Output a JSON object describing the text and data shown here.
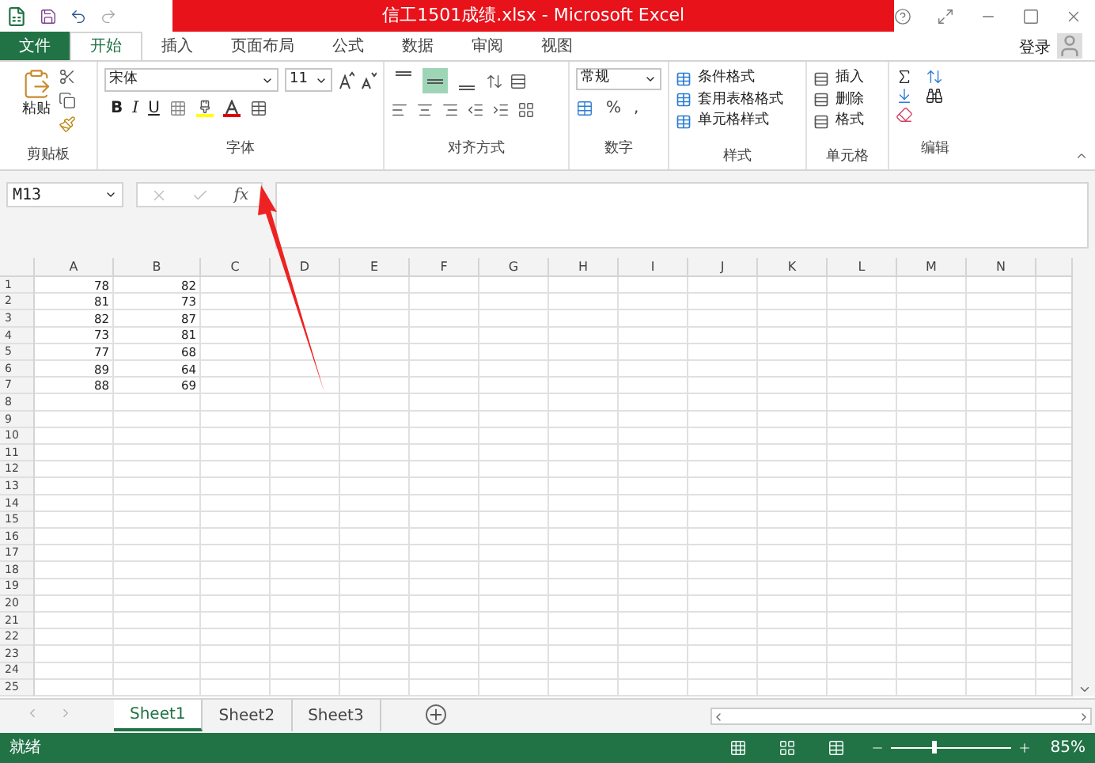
{
  "app": {
    "title": "信工1501成绩.xlsx - Microsoft Excel",
    "account": "登录"
  },
  "tabs": [
    {
      "label": "文件",
      "kind": "file",
      "selected": false
    },
    {
      "label": "开始",
      "kind": "tab",
      "selected": true
    },
    {
      "label": "插入",
      "kind": "tab",
      "selected": false
    },
    {
      "label": "页面布局",
      "kind": "tab",
      "selected": false
    },
    {
      "label": "公式",
      "kind": "tab",
      "selected": false
    },
    {
      "label": "数据",
      "kind": "tab",
      "selected": false
    },
    {
      "label": "审阅",
      "kind": "tab",
      "selected": false
    },
    {
      "label": "视图",
      "kind": "tab",
      "selected": false
    }
  ],
  "ribbon": {
    "clipboard": {
      "paste": "粘贴",
      "label": "剪贴板"
    },
    "font": {
      "name": "宋体",
      "size": "11",
      "bold": "B",
      "italic": "I",
      "underline": "U",
      "label": "字体"
    },
    "alignment": {
      "vertical": [
        {
          "kind": "top",
          "selected": false
        },
        {
          "kind": "middle",
          "selected": true
        },
        {
          "kind": "bottom",
          "selected": false
        }
      ],
      "label": "对齐方式"
    },
    "number": {
      "format": "常规",
      "percent": "%",
      "comma": ",",
      "label": "数字"
    },
    "styles": {
      "items": [
        "条件格式",
        "套用表格格式",
        "单元格样式"
      ],
      "label": "样式"
    },
    "cells": {
      "items": [
        "插入",
        "删除",
        "格式"
      ],
      "label": "单元格"
    },
    "editing": {
      "label": "编辑"
    }
  },
  "formula_bar": {
    "name_box": "M13",
    "function": "fx"
  },
  "sheet": {
    "columns": [
      "A",
      "B",
      "C",
      "D",
      "E",
      "F",
      "G",
      "H",
      "I",
      "J",
      "K",
      "L",
      "M",
      "N"
    ],
    "rows": [
      {
        "number": "1",
        "cells": [
          "78",
          "82"
        ]
      },
      {
        "number": "2",
        "cells": [
          "81",
          "73"
        ]
      },
      {
        "number": "3",
        "cells": [
          "82",
          "87"
        ]
      },
      {
        "number": "4",
        "cells": [
          "73",
          "81"
        ]
      },
      {
        "number": "5",
        "cells": [
          "77",
          "68"
        ]
      },
      {
        "number": "6",
        "cells": [
          "89",
          "64"
        ]
      },
      {
        "number": "7",
        "cells": [
          "88",
          "69"
        ]
      },
      {
        "number": "8",
        "cells": []
      },
      {
        "number": "9",
        "cells": []
      },
      {
        "number": "10",
        "cells": []
      },
      {
        "number": "11",
        "cells": []
      },
      {
        "number": "12",
        "cells": []
      },
      {
        "number": "13",
        "cells": []
      },
      {
        "number": "14",
        "cells": []
      },
      {
        "number": "15",
        "cells": []
      },
      {
        "number": "16",
        "cells": []
      },
      {
        "number": "17",
        "cells": []
      },
      {
        "number": "18",
        "cells": []
      },
      {
        "number": "19",
        "cells": []
      },
      {
        "number": "20",
        "cells": []
      },
      {
        "number": "21",
        "cells": []
      },
      {
        "number": "22",
        "cells": []
      },
      {
        "number": "23",
        "cells": []
      },
      {
        "number": "24",
        "cells": []
      },
      {
        "number": "25",
        "cells": []
      }
    ]
  },
  "sheets": [
    {
      "name": "Sheet1",
      "selected": true
    },
    {
      "name": "Sheet2",
      "selected": false
    },
    {
      "name": "Sheet3",
      "selected": false
    }
  ],
  "status": {
    "text": "就绪",
    "zoom": "85%",
    "level": 0.36
  }
}
